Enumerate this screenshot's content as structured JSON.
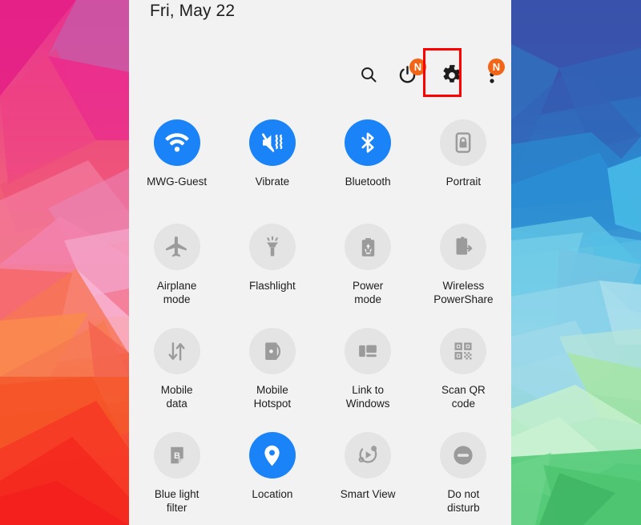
{
  "status": {
    "date": "Fri, May 22"
  },
  "colors": {
    "panel_background": "#f2f2f2",
    "tile_active": "#1a83f7",
    "tile_inactive": "#e4e4e4",
    "icon_inactive": "#9b9b9b",
    "badge": "#f36516",
    "highlight_box": "#ff0000",
    "text": "#1d1d1d"
  },
  "toolbar": {
    "search": {
      "label": "Search",
      "icon": "search-icon"
    },
    "power": {
      "label": "Power off",
      "icon": "power-icon",
      "badge": "N"
    },
    "settings": {
      "label": "Settings",
      "icon": "gear-icon",
      "highlighted": true
    },
    "more": {
      "label": "More options",
      "icon": "three-dot-menu-icon",
      "badge": "N"
    }
  },
  "tiles": [
    {
      "label": "MWG-Guest",
      "icon": "wifi-icon",
      "active": true
    },
    {
      "label": "Vibrate",
      "icon": "vibrate-icon",
      "active": true
    },
    {
      "label": "Bluetooth",
      "icon": "bluetooth-icon",
      "active": true
    },
    {
      "label": "Portrait",
      "icon": "screen-rotation-lock-icon",
      "active": false
    },
    {
      "label": "Airplane\nmode",
      "icon": "airplane-icon",
      "active": false
    },
    {
      "label": "Flashlight",
      "icon": "flashlight-icon",
      "active": false
    },
    {
      "label": "Power\nmode",
      "icon": "power-mode-battery-icon",
      "active": false
    },
    {
      "label": "Wireless\nPowerShare",
      "icon": "wireless-powershare-icon",
      "active": false
    },
    {
      "label": "Mobile\ndata",
      "icon": "mobile-data-arrows-icon",
      "active": false
    },
    {
      "label": "Mobile\nHotspot",
      "icon": "hotspot-icon",
      "active": false
    },
    {
      "label": "Link to\nWindows",
      "icon": "link-to-windows-icon",
      "active": false
    },
    {
      "label": "Scan QR\ncode",
      "icon": "qr-code-icon",
      "active": false
    },
    {
      "label": "Blue light\nfilter",
      "icon": "blue-light-filter-icon",
      "active": false
    },
    {
      "label": "Location",
      "icon": "location-pin-icon",
      "active": true
    },
    {
      "label": "Smart View",
      "icon": "smart-view-icon",
      "active": false
    },
    {
      "label": "Do not\ndisturb",
      "icon": "do-not-disturb-icon",
      "active": false
    }
  ]
}
